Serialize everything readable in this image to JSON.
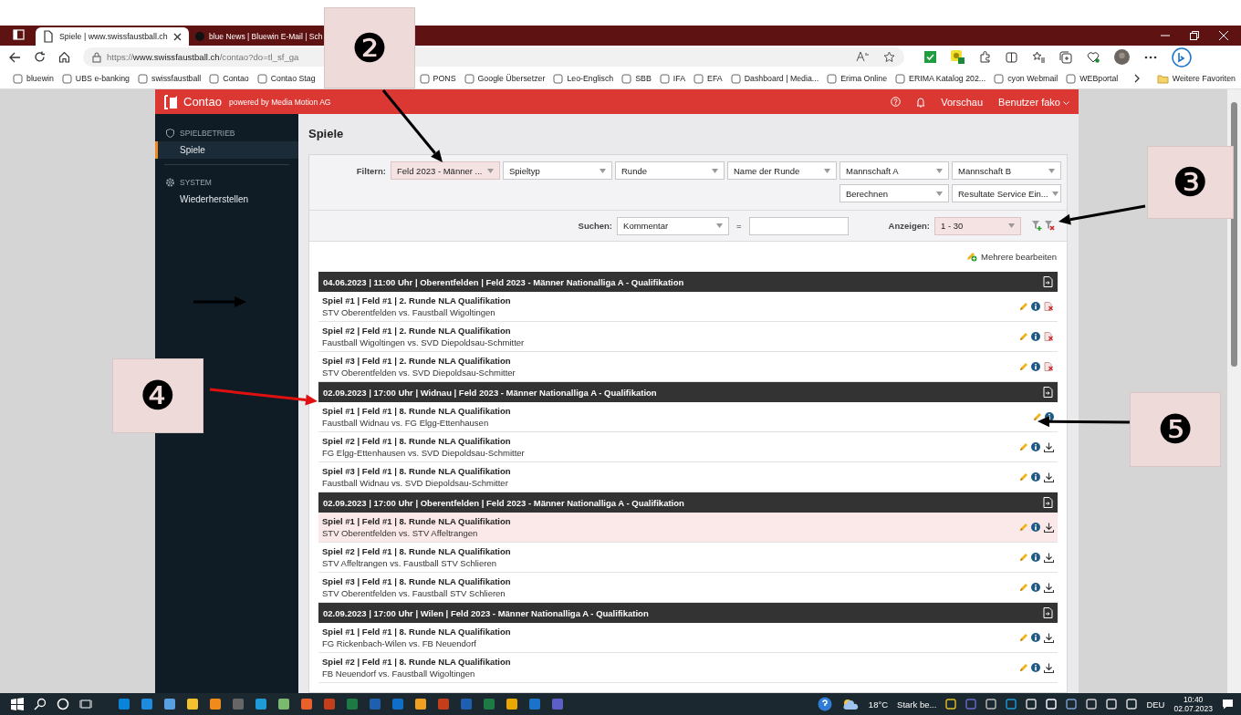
{
  "browser": {
    "tabs": [
      {
        "title": "Spiele | www.swissfaustball.ch",
        "selected": true
      },
      {
        "title": "blue News | Bluewin E-Mail | Sch",
        "selected": false
      }
    ],
    "url": {
      "scheme": "https://",
      "host": "www.swissfaustball.ch",
      "path": "/contao?do=tl_sf_ga"
    },
    "bookmarks": [
      "bluewin",
      "UBS e-banking",
      "swissfaustball",
      "Contao",
      "Contao Stag",
      "PONS",
      "Google Übersetzer",
      "Leo-Englisch",
      "SBB",
      "IFA",
      "EFA",
      "Dashboard | Media...",
      "Erima Online",
      "ERIMA Katalog 202...",
      "cyon Webmail",
      "WEBportal"
    ],
    "more_favorites": "Weitere Favoriten"
  },
  "app": {
    "brand": "Contao",
    "tagline": "powered by Media Motion AG",
    "header_links": [
      "Vorschau",
      "Benutzer fako"
    ]
  },
  "sidebar": [
    {
      "title": "SPIELBETRIEB",
      "items": [
        {
          "label": "Spiele",
          "selected": true
        }
      ]
    },
    {
      "title": "SYSTEM",
      "items": [
        {
          "label": "Wiederherstellen",
          "selected": false
        }
      ]
    }
  ],
  "page_title": "Spiele",
  "filter": {
    "label": "Filtern:",
    "selects": [
      {
        "value": "Feld 2023 - Männer ...",
        "active": true
      },
      {
        "value": "Spieltyp",
        "active": false
      },
      {
        "value": "Runde",
        "active": false
      },
      {
        "value": "Name der Runde",
        "active": false
      },
      {
        "value": "Mannschaft A",
        "active": false
      },
      {
        "value": "Mannschaft B",
        "active": false
      },
      {
        "value": "Berechnen",
        "active": false
      },
      {
        "value": "Resultate Service Ein...",
        "active": false
      }
    ]
  },
  "search": {
    "label": "Suchen:",
    "field": "Kommentar",
    "operator": "="
  },
  "limit": {
    "label": "Anzeigen:",
    "value": "1 - 30",
    "active": true
  },
  "edit_multiple": "Mehrere bearbeiten",
  "groups": [
    {
      "header": "04.06.2023 | 11:00 Uhr | Oberentfelden | Feld 2023 - Männer Nationalliga A - Qualifikation",
      "games": [
        {
          "title": "Spiel #1 | Feld #1 | 2. Runde NLA Qualifikation",
          "teams": "STV Oberentfelden vs. Faustball Wigoltingen",
          "selected": false,
          "kind": "deletable"
        },
        {
          "title": "Spiel #2 | Feld #1 | 2. Runde NLA Qualifikation",
          "teams": "Faustball Wigoltingen vs. SVD Diepoldsau-Schmitter",
          "selected": false,
          "kind": "deletable"
        },
        {
          "title": "Spiel #3 | Feld #1 | 2. Runde NLA Qualifikation",
          "teams": "STV Oberentfelden vs. SVD Diepoldsau-Schmitter",
          "selected": false,
          "kind": "deletable"
        }
      ]
    },
    {
      "header": "02.09.2023 | 17:00 Uhr | Widnau | Feld 2023 - Männer Nationalliga A - Qualifikation",
      "games": [
        {
          "title": "Spiel #1 | Feld #1 | 8. Runde NLA Qualifikation",
          "teams": "Faustball Widnau vs. FG Elgg-Ettenhausen",
          "selected": false,
          "kind": "plain"
        },
        {
          "title": "Spiel #2 | Feld #1 | 8. Runde NLA Qualifikation",
          "teams": "FG Elgg-Ettenhausen vs. SVD Diepoldsau-Schmitter",
          "selected": false,
          "kind": "downloadable"
        },
        {
          "title": "Spiel #3 | Feld #1 | 8. Runde NLA Qualifikation",
          "teams": "Faustball Widnau vs. SVD Diepoldsau-Schmitter",
          "selected": false,
          "kind": "downloadable"
        }
      ]
    },
    {
      "header": "02.09.2023 | 17:00 Uhr | Oberentfelden | Feld 2023 - Männer Nationalliga A - Qualifikation",
      "games": [
        {
          "title": "Spiel #1 | Feld #1 | 8. Runde NLA Qualifikation",
          "teams": "STV Oberentfelden vs. STV Affeltrangen",
          "selected": true,
          "kind": "downloadable"
        },
        {
          "title": "Spiel #2 | Feld #1 | 8. Runde NLA Qualifikation",
          "teams": "STV Affeltrangen vs. Faustball STV Schlieren",
          "selected": false,
          "kind": "downloadable"
        },
        {
          "title": "Spiel #3 | Feld #1 | 8. Runde NLA Qualifikation",
          "teams": "STV Oberentfelden vs. Faustball STV Schlieren",
          "selected": false,
          "kind": "downloadable"
        }
      ]
    },
    {
      "header": "02.09.2023 | 17:00 Uhr | Wilen | Feld 2023 - Männer Nationalliga A - Qualifikation",
      "games": [
        {
          "title": "Spiel #1 | Feld #1 | 8. Runde NLA Qualifikation",
          "teams": "FG Rickenbach-Wilen vs. FB Neuendorf",
          "selected": false,
          "kind": "downloadable"
        },
        {
          "title": "Spiel #2 | Feld #1 | 8. Runde NLA Qualifikation",
          "teams": "FB Neuendorf vs. Faustball Wigoltingen",
          "selected": false,
          "kind": "downloadable"
        }
      ]
    }
  ],
  "annotations": [
    {
      "label": "❷"
    },
    {
      "label": "❸"
    },
    {
      "label": "❹"
    },
    {
      "label": "❺"
    }
  ],
  "taskbar": {
    "temperature": "18°C",
    "weather": "Stark be...",
    "language": "DEU",
    "time": "10:40",
    "date": "02.07.2023"
  }
}
